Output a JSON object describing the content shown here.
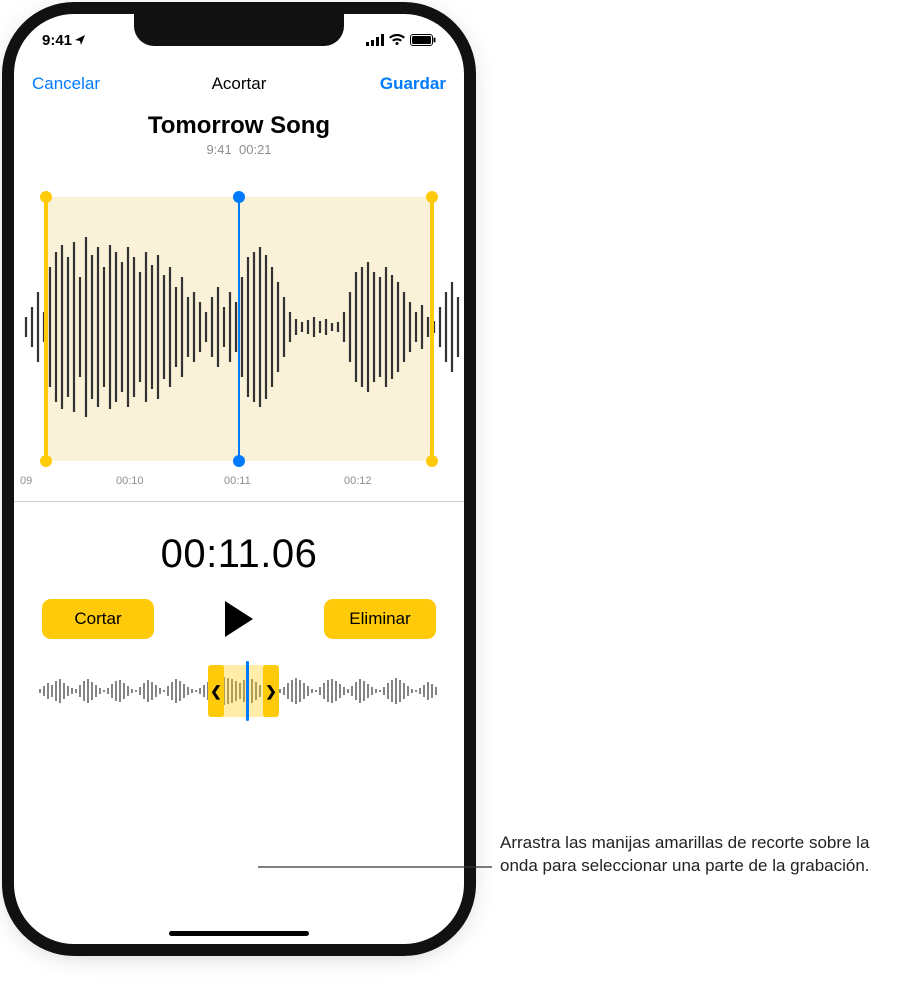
{
  "statusbar": {
    "time": "9:41"
  },
  "nav": {
    "cancel": "Cancelar",
    "title": "Acortar",
    "save": "Guardar"
  },
  "recording": {
    "title": "Tomorrow Song",
    "time": "9:41",
    "duration": "00:21"
  },
  "timeline": {
    "t0": "09",
    "t1": "00:10",
    "t2": "00:11",
    "t3": "00:12"
  },
  "readout": "00:11.06",
  "buttons": {
    "cut": "Cortar",
    "delete": "Eliminar"
  },
  "overview_handles": {
    "left": "❮",
    "right": "❯"
  },
  "annotation": "Arrastra las manijas amarillas de recorte sobre la onda para seleccionar una parte de la grabación."
}
